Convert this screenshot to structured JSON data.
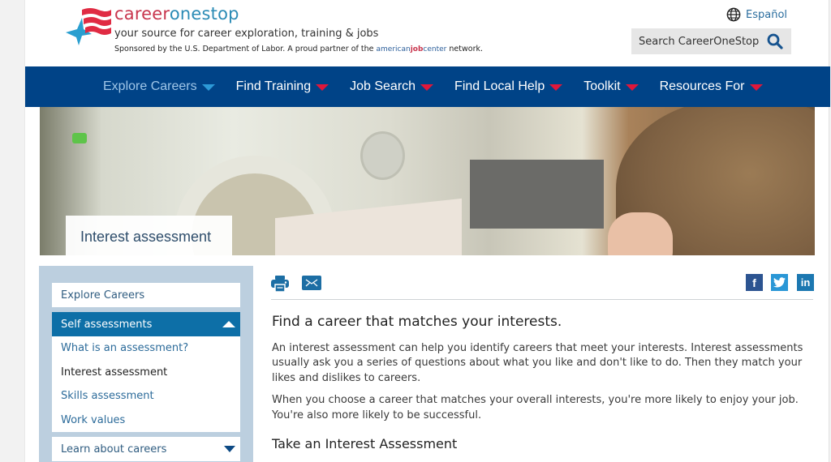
{
  "header": {
    "brand_part1": "career",
    "brand_part2": "onestop",
    "tagline": "your source for career exploration, training & jobs",
    "sponsor_text": "Sponsored by the U.S. Department of Labor. A proud partner of the",
    "ajc_part1": "american",
    "ajc_part2": "job",
    "ajc_part3": "center",
    "sponsor_suffix": "network.",
    "language_link": "Español",
    "search_placeholder": "Search CareerOneStop"
  },
  "nav": {
    "items": [
      {
        "label": "Explore Careers",
        "active": true
      },
      {
        "label": "Find Training"
      },
      {
        "label": "Job Search"
      },
      {
        "label": "Find Local Help"
      },
      {
        "label": "Toolkit"
      },
      {
        "label": "Resources For"
      }
    ]
  },
  "hero": {
    "label": "Interest assessment"
  },
  "sidebar": {
    "top_link": "Explore Careers",
    "open_section": "Self assessments",
    "sub_items": [
      {
        "label": "What is an assessment?"
      },
      {
        "label": "Interest assessment",
        "current": true
      },
      {
        "label": "Skills assessment"
      },
      {
        "label": "Work values"
      }
    ],
    "collapsed_section": "Learn about careers"
  },
  "tools": {
    "print": "print-icon",
    "email": "email-icon",
    "facebook": "f",
    "twitter": "twitter-icon",
    "linkedin": "in"
  },
  "content": {
    "heading": "Find a career that matches your interests.",
    "para1": "An interest assessment can help you identify careers that meet your interests. Interest assessments usually ask you a series of questions about what you like and don't like to do. Then they match your likes and dislikes to careers.",
    "para2": "When you choose a career that matches your overall interests, you're more likely to enjoy your job. You're also more likely to be successful.",
    "subheading": "Take an Interest Assessment"
  },
  "colors": {
    "nav_bg": "#004387",
    "nav_arrow": "#e0173a",
    "active_arrow": "#2d9ad7",
    "sidebar_bg": "#bccfdf",
    "sidebar_active": "#0d6fa7",
    "brand_red": "#c8354d",
    "brand_blue": "#2b8bb5"
  }
}
